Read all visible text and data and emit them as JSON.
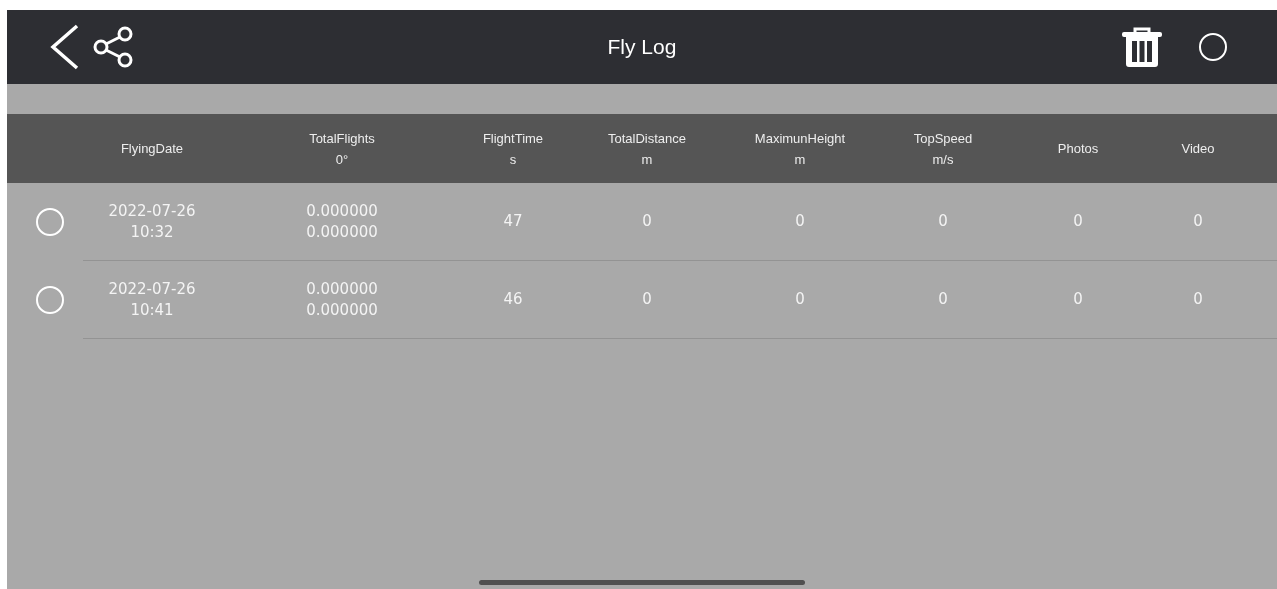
{
  "header": {
    "title": "Fly Log",
    "select_all": {
      "selected": false
    }
  },
  "table": {
    "columns": [
      {
        "label": "FlyingDate"
      },
      {
        "label": "TotalFlights",
        "unit": "0°"
      },
      {
        "label": "FlightTime",
        "unit": "s"
      },
      {
        "label": "TotalDistance",
        "unit": "m"
      },
      {
        "label": "MaximunHeight",
        "unit": "m"
      },
      {
        "label": "TopSpeed",
        "unit": "m/s"
      },
      {
        "label": "Photos"
      },
      {
        "label": "Video"
      }
    ],
    "rows": [
      {
        "selected": false,
        "cells": [
          [
            "2022-07-26",
            "10:32"
          ],
          [
            "0.000000",
            "0.000000"
          ],
          [
            "47"
          ],
          [
            "0"
          ],
          [
            "0"
          ],
          [
            "0"
          ],
          [
            "0"
          ],
          [
            "0"
          ]
        ]
      },
      {
        "selected": false,
        "cells": [
          [
            "2022-07-26",
            "10:41"
          ],
          [
            "0.000000",
            "0.000000"
          ],
          [
            "46"
          ],
          [
            "0"
          ],
          [
            "0"
          ],
          [
            "0"
          ],
          [
            "0"
          ],
          [
            "0"
          ]
        ]
      }
    ]
  }
}
